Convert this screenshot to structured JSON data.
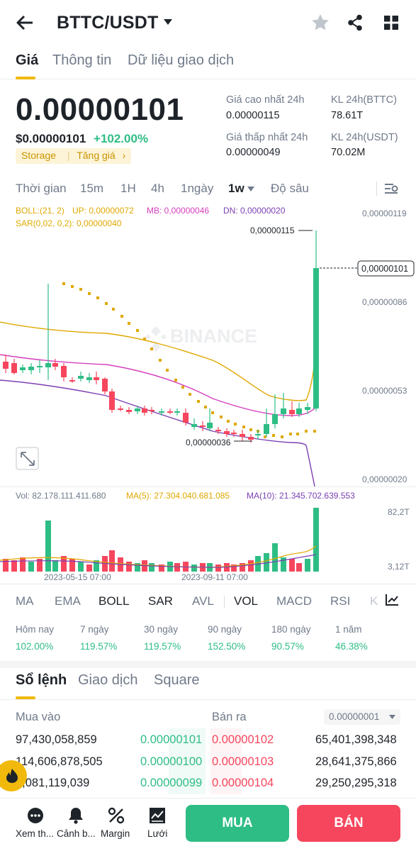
{
  "header": {
    "pair": "BTTC/USDT",
    "icons": [
      "back-arrow-icon",
      "star-icon",
      "share-icon",
      "grid-icon"
    ]
  },
  "tabs": [
    "Giá",
    "Thông tin",
    "Dữ liệu giao dịch"
  ],
  "price": {
    "last": "0.00000101",
    "usd": "$0.00000101",
    "change": "+102.00%",
    "tag1": "Storage",
    "tag2": "Tăng giá"
  },
  "stats": {
    "high_label": "Giá cao nhất 24h",
    "high": "0.00000115",
    "low_label": "Giá thấp nhất 24h",
    "low": "0.00000049",
    "vol_btt_label": "KL 24h(BTTC)",
    "vol_btt": "78.61T",
    "vol_usdt_label": "KL 24h(USDT)",
    "vol_usdt": "70.02M"
  },
  "timeframes": [
    "Thời gian",
    "15m",
    "1H",
    "4h",
    "1ngày",
    "1w",
    "Độ sâu"
  ],
  "indicator_text": {
    "boll": "BOLL:(21, 2)",
    "up": "UP: 0,00000072",
    "mb": "MB: 0,00000046",
    "dn": "DN: 0,00000020",
    "sar": "SAR(0,02, 0,2): 0,00000040"
  },
  "chart_labels": {
    "axis": [
      "0,00000119",
      "0,00000086",
      "0,00000053",
      "0,00000020"
    ],
    "high_mark": "0,00000115",
    "low_mark": "0,00000036",
    "current": "0,00000101",
    "watermark": "BINANCE"
  },
  "volume": {
    "vol": "Vol: 82.178.111.411.680",
    "ma5": "MA(5): 27.304.040.681.085",
    "ma10": "MA(10): 21.345.702.639.553",
    "axis_top": "82,2T",
    "axis_bottom": "3,12T",
    "date1": "2023-05-15 07:00",
    "date2": "2023-09-11 07:00"
  },
  "indicators": [
    "MA",
    "EMA",
    "BOLL",
    "SAR",
    "AVL",
    "VOL",
    "MACD",
    "RSI",
    "KD"
  ],
  "performance": [
    {
      "label": "Hôm nay",
      "value": "102.00%"
    },
    {
      "label": "7 ngày",
      "value": "119.57%"
    },
    {
      "label": "30 ngày",
      "value": "119.57%"
    },
    {
      "label": "90 ngày",
      "value": "152.50%"
    },
    {
      "label": "180 ngày",
      "value": "90.57%"
    },
    {
      "label": "1 năm",
      "value": "46.38%"
    }
  ],
  "orderbook": {
    "tabs": [
      "Sổ lệnh",
      "Giao dịch",
      "Square"
    ],
    "buy_label": "Mua vào",
    "sell_label": "Bán ra",
    "precision": "0.00000001",
    "rows": [
      {
        "bid_qty": "97,430,058,859",
        "bid": "0.00000101",
        "ask": "0.00000102",
        "ask_qty": "65,401,398,348"
      },
      {
        "bid_qty": "114,606,878,505",
        "bid": "0.00000100",
        "ask": "0.00000103",
        "ask_qty": "28,641,375,866"
      },
      {
        "bid_qty": "3,081,119,039",
        "bid": "0.00000099",
        "ask": "0.00000104",
        "ask_qty": "29,250,295,318"
      }
    ]
  },
  "bottom": {
    "items": [
      "Xem th...",
      "Cảnh b...",
      "Margin",
      "Lưới"
    ],
    "buy": "MUA",
    "sell": "BÁN"
  },
  "colors": {
    "up": "#2ebd85",
    "down": "#f6465d",
    "accent": "#f0b90b"
  }
}
